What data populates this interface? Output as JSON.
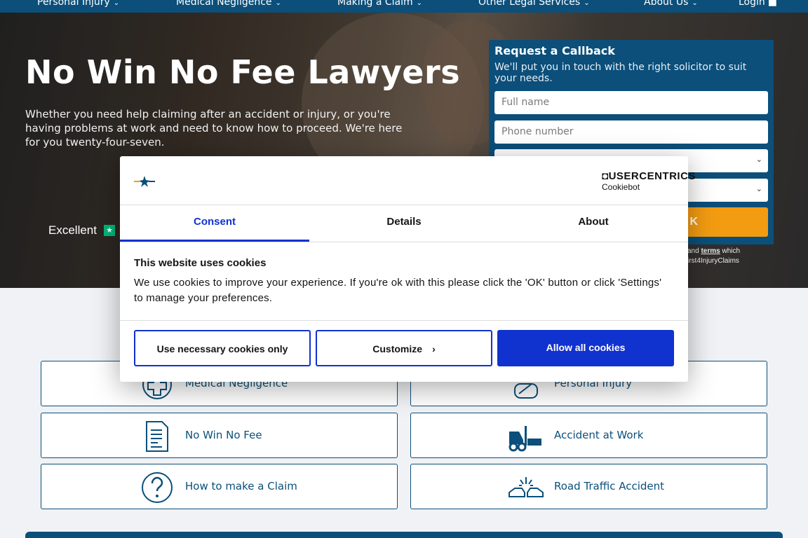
{
  "nav": {
    "items": [
      {
        "label": "Personal Injury"
      },
      {
        "label": "Medical Negligence"
      },
      {
        "label": "Making a Claim"
      },
      {
        "label": "Other Legal Services"
      },
      {
        "label": "About Us"
      },
      {
        "label": "Login"
      }
    ]
  },
  "hero": {
    "title": "No Win No Fee Lawyers",
    "subtitle": "Whether you need help claiming after an accident or injury, or you're having problems at work and need to know how to proceed. We're here for you twenty-four-seven.",
    "rating_label": "Excellent"
  },
  "callback": {
    "title": "Request a Callback",
    "description": "We'll put you in touch with the right solicitor to suit your needs.",
    "name_placeholder": "Full name",
    "phone_placeholder": "Phone number",
    "submit_label": "K",
    "terms_line1_pre": "and",
    "terms_link": "terms",
    "terms_line1_post": "which",
    "terms_line2": "irst4InjuryClaims"
  },
  "categories": [
    {
      "label": "Medical Negligence",
      "icon": "medical-cross-icon"
    },
    {
      "label": "Personal Injury",
      "icon": "injury-icon"
    },
    {
      "label": "No Win No Fee",
      "icon": "document-icon"
    },
    {
      "label": "Accident at Work",
      "icon": "forklift-icon"
    },
    {
      "label": "How to make a Claim",
      "icon": "question-icon"
    },
    {
      "label": "Road Traffic Accident",
      "icon": "car-crash-icon"
    }
  ],
  "cookie": {
    "brand": "USERCENTRICS",
    "brand_sub": "Cookiebot",
    "tabs": [
      "Consent",
      "Details",
      "About"
    ],
    "heading": "This website uses cookies",
    "text": "We use cookies to improve your experience. If you're ok with this please click the 'OK' button or click 'Settings' to manage your preferences.",
    "btn_necessary": "Use necessary cookies only",
    "btn_customize": "Customize",
    "btn_allow": "Allow all cookies",
    "accent": "#1032cf"
  }
}
